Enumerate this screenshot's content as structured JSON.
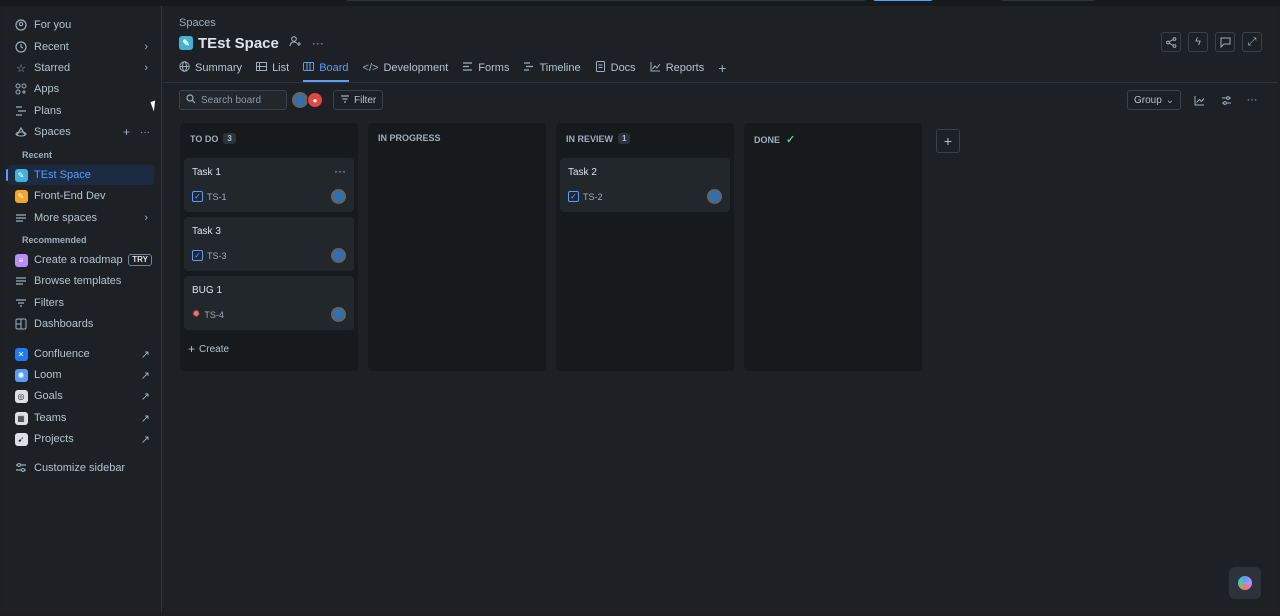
{
  "sidebar": {
    "items": [
      {
        "label": "For you",
        "icon": "user-circle-icon"
      },
      {
        "label": "Recent",
        "icon": "clock-icon"
      },
      {
        "label": "Starred",
        "icon": "star-icon"
      },
      {
        "label": "Apps",
        "icon": "apps-icon"
      },
      {
        "label": "Plans",
        "icon": "plans-icon"
      },
      {
        "label": "Spaces",
        "icon": "spaces-icon"
      }
    ],
    "recent_label": "Recent",
    "recent_spaces": [
      {
        "label": "TEst Space",
        "icon_color": "#42b2d7",
        "selected": true
      },
      {
        "label": "Front-End Dev",
        "icon_color": "#f5a623"
      },
      {
        "label": "More spaces"
      }
    ],
    "recommended_label": "Recommended",
    "recommended": [
      {
        "label": "Create a roadmap",
        "badge": "TRY",
        "icon_color": "#b58dff"
      },
      {
        "label": "Browse templates"
      }
    ],
    "filters": "Filters",
    "dashboards": "Dashboards",
    "apps": [
      {
        "label": "Confluence",
        "icon_color": "#1d7afc"
      },
      {
        "label": "Loom",
        "icon_color": "#579dff"
      },
      {
        "label": "Goals",
        "icon_color": "#dcdfe4"
      },
      {
        "label": "Teams",
        "icon_color": "#dcdfe4"
      },
      {
        "label": "Projects",
        "icon_color": "#dcdfe4"
      }
    ],
    "customize": "Customize sidebar"
  },
  "header": {
    "breadcrumb": "Spaces",
    "title": "TEst Space",
    "tabs": [
      {
        "label": "Summary",
        "icon": "globe-icon"
      },
      {
        "label": "List",
        "icon": "list-icon"
      },
      {
        "label": "Board",
        "icon": "board-icon",
        "active": true
      },
      {
        "label": "Development",
        "icon": "code-icon"
      },
      {
        "label": "Forms",
        "icon": "forms-icon"
      },
      {
        "label": "Timeline",
        "icon": "timeline-icon"
      },
      {
        "label": "Docs",
        "icon": "docs-icon"
      },
      {
        "label": "Reports",
        "icon": "reports-icon"
      }
    ]
  },
  "toolbar": {
    "search_placeholder": "Search board",
    "filter_label": "Filter",
    "group_label": "Group"
  },
  "board": {
    "columns": [
      {
        "name": "TO DO",
        "count": "3",
        "cards": [
          {
            "title": "Task 1",
            "key": "TS-1",
            "type": "task"
          },
          {
            "title": "Task 3",
            "key": "TS-3",
            "type": "task"
          },
          {
            "title": "BUG 1",
            "key": "TS-4",
            "type": "bug"
          }
        ],
        "create": "Create"
      },
      {
        "name": "IN PROGRESS",
        "count": "",
        "cards": []
      },
      {
        "name": "IN REVIEW",
        "count": "1",
        "cards": [
          {
            "title": "Task 2",
            "key": "TS-2",
            "type": "task"
          }
        ]
      },
      {
        "name": "DONE",
        "count": "",
        "done": true,
        "cards": []
      }
    ]
  },
  "colors": {
    "accent": "#579dff",
    "background": "#1d2125",
    "column": "#161a1d",
    "card": "#22272b"
  }
}
